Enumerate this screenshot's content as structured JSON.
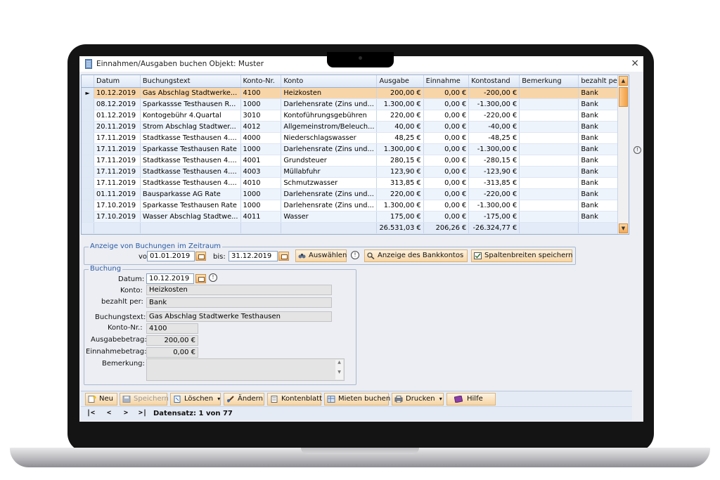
{
  "window": {
    "title": "Einnahmen/Ausgaben buchen  Objekt: Muster",
    "close_glyph": "×"
  },
  "grid": {
    "columns": [
      "Datum",
      "Buchungstext",
      "Konto-Nr.",
      "Konto",
      "Ausgabe",
      "Einnahme",
      "Kontostand",
      "Bemerkung",
      "bezahlt per"
    ],
    "current_row_marker": "►",
    "rows": [
      [
        "10.12.2019",
        "Gas Abschlag Stadtwerke...",
        "4100",
        "Heizkosten",
        "200,00 €",
        "0,00 €",
        "-200,00 €",
        "",
        "Bank"
      ],
      [
        "08.12.2019",
        "Sparkassse Testhausen R...",
        "1000",
        "Darlehensrate (Zins und...",
        "1.300,00 €",
        "0,00 €",
        "-1.300,00 €",
        "",
        "Bank"
      ],
      [
        "01.12.2019",
        "Kontogebühr 4.Quartal",
        "3010",
        "Kontoführungsgebühren",
        "220,00 €",
        "0,00 €",
        "-220,00 €",
        "",
        "Bank"
      ],
      [
        "20.11.2019",
        "Strom Abschlag Stadtwer...",
        "4012",
        "Allgemeinstrom/Beleuch...",
        "40,00 €",
        "0,00 €",
        "-40,00 €",
        "",
        "Bank"
      ],
      [
        "17.11.2019",
        "Stadtkasse Testhausen 4....",
        "4000",
        "Niederschlagswasser",
        "48,25 €",
        "0,00 €",
        "-48,25 €",
        "",
        "Bank"
      ],
      [
        "17.11.2019",
        "Sparkasse Testhausen Rate",
        "1000",
        "Darlehensrate (Zins und...",
        "1.300,00 €",
        "0,00 €",
        "-1.300,00 €",
        "",
        "Bank"
      ],
      [
        "17.11.2019",
        "Stadtkasse Testhausen 4....",
        "4001",
        "Grundsteuer",
        "280,15 €",
        "0,00 €",
        "-280,15 €",
        "",
        "Bank"
      ],
      [
        "17.11.2019",
        "Stadtkasse Testhausen 4....",
        "4003",
        "Müllabfuhr",
        "123,90 €",
        "0,00 €",
        "-123,90 €",
        "",
        "Bank"
      ],
      [
        "17.11.2019",
        "Stadtkasse Testhausen 4....",
        "4010",
        "Schmutzwasser",
        "313,85 €",
        "0,00 €",
        "-313,85 €",
        "",
        "Bank"
      ],
      [
        "01.11.2019",
        "Bausparkasse AG Rate",
        "1000",
        "Darlehensrate (Zins und...",
        "220,00 €",
        "0,00 €",
        "-220,00 €",
        "",
        "Bank"
      ],
      [
        "17.10.2019",
        "Sparkasse Testhausen Rate",
        "1000",
        "Darlehensrate (Zins und...",
        "1.300,00 €",
        "0,00 €",
        "-1.300,00 €",
        "",
        "Bank"
      ],
      [
        "17.10.2019",
        "Wasser Abschlag Stadtwe...",
        "4011",
        "Wasser",
        "175,00 €",
        "0,00 €",
        "-175,00 €",
        "",
        "Bank"
      ]
    ],
    "totals": [
      "",
      "",
      "",
      "",
      "26.531,03 €",
      "206,26 €",
      "-26.324,77 €",
      "",
      ""
    ]
  },
  "period": {
    "legend": "Anzeige von Buchungen im Zeitraum",
    "from_label": "von:",
    "from_value": "01.01.2019",
    "to_label": "bis:",
    "to_value": "31.12.2019",
    "select_button": "Auswählen",
    "bank_button": "Anzeige des Bankkontos",
    "save_columns_button": "Spaltenbreiten speichern",
    "info_glyph": "!"
  },
  "booking": {
    "legend": "Buchung",
    "date_label": "Datum:",
    "date_value": "10.12.2019",
    "account_label": "Konto:",
    "account_value": "Heizkosten",
    "paid_by_label": "bezahlt per:",
    "paid_by_value": "Bank",
    "text_label": "Buchungstext:",
    "text_value": "Gas Abschlag Stadtwerke Testhausen",
    "account_no_label": "Konto-Nr.:",
    "account_no_value": "4100",
    "expense_label": "Ausgabebetrag:",
    "expense_value": "200,00 €",
    "income_label": "Einnahmebetrag:",
    "income_value": "0,00 €",
    "remark_label": "Bemerkung:",
    "remark_value": ""
  },
  "toolbar": {
    "new": "Neu",
    "save": "Speichern",
    "delete": "Löschen",
    "edit": "Ändern",
    "account_sheet": "Kontenblatt",
    "book_rent": "Mieten buchen",
    "print": "Drucken",
    "help": "Hilfe",
    "dropdown_glyph": "▾"
  },
  "navigator": {
    "first": "|<",
    "prev": "<",
    "next": ">",
    "last": ">|",
    "record_label": "Datensatz: 1 von 77"
  },
  "colors": {
    "selection": "#f8d5a8",
    "accent_orange": "#f3a045",
    "legend_blue": "#2a5aa6",
    "grid_border": "#9ab0cf"
  }
}
